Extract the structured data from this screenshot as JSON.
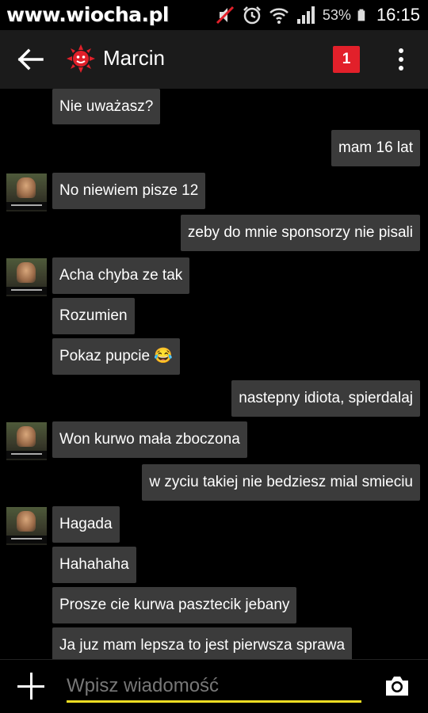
{
  "status_bar": {
    "watermark": "www.wiocha.pl",
    "icons": [
      "mail-icon",
      "android-icon",
      "notification-icon",
      "mute-icon",
      "alarm-icon",
      "wifi-icon",
      "signal-icon",
      "battery-icon"
    ],
    "battery_percent": "53%",
    "time": "16:15"
  },
  "toolbar": {
    "contact_name": "Marcin",
    "unread_count": "1",
    "accent_color": "#e2202a"
  },
  "messages": [
    {
      "direction": "in",
      "text": "Nie uważasz?",
      "avatar": false
    },
    {
      "direction": "out",
      "text": "mam 16 lat"
    },
    {
      "direction": "in",
      "text": "No niewiem pisze 12",
      "avatar": true
    },
    {
      "direction": "out",
      "text": "zeby do mnie sponsorzy nie pisali"
    },
    {
      "direction": "in",
      "text": "Acha chyba ze tak",
      "avatar": true
    },
    {
      "direction": "in",
      "text": "Rozumien",
      "avatar": false
    },
    {
      "direction": "in",
      "text": "Pokaz pupcie 😂",
      "avatar": false
    },
    {
      "direction": "out",
      "text": "nastepny idiota, spierdalaj"
    },
    {
      "direction": "in",
      "text": "Won kurwo mała zboczona",
      "avatar": true
    },
    {
      "direction": "out",
      "text": "w zyciu takiej nie bedziesz mial smieciu"
    },
    {
      "direction": "in",
      "text": "Hagada",
      "avatar": true
    },
    {
      "direction": "in",
      "text": "Hahahaha",
      "avatar": false
    },
    {
      "direction": "in",
      "text": "Prosze cie kurwa pasztecik jebany",
      "avatar": false
    },
    {
      "direction": "in",
      "text": "Ja juz mam lepsza to jest pierwsza sprawa",
      "avatar": false
    }
  ],
  "input": {
    "placeholder": "Wpisz wiadomość",
    "value": "",
    "underline_color": "#f1de23"
  }
}
